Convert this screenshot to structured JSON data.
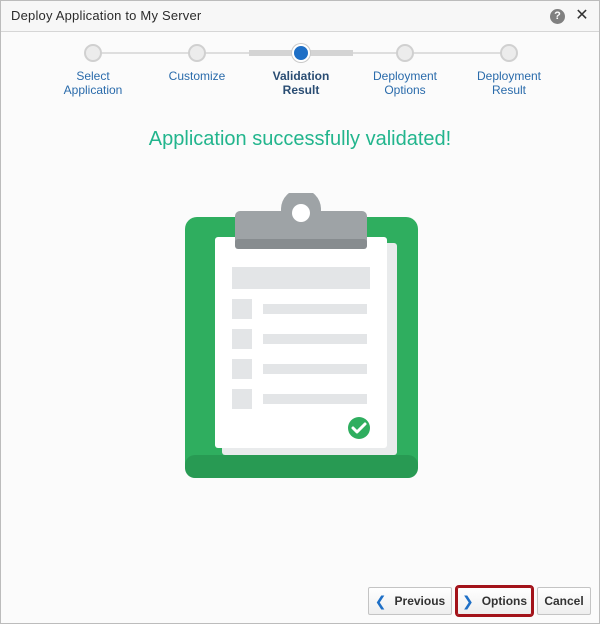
{
  "window": {
    "title": "Deploy Application to My Server"
  },
  "steps": [
    {
      "label_line1": "Select",
      "label_line2": "Application"
    },
    {
      "label_line1": "Customize",
      "label_line2": ""
    },
    {
      "label_line1": "Validation",
      "label_line2": "Result"
    },
    {
      "label_line1": "Deployment",
      "label_line2": "Options"
    },
    {
      "label_line1": "Deployment",
      "label_line2": "Result"
    }
  ],
  "current_step_index": 2,
  "main": {
    "headline": "Application successfully validated!"
  },
  "footer": {
    "previous_label": "Previous",
    "options_label": "Options",
    "cancel_label": "Cancel"
  },
  "icons": {
    "help": "help-icon",
    "close": "close-icon",
    "previous": "chevron-left-icon",
    "next": "chevron-right-icon",
    "illustration": "clipboard-check-icon"
  },
  "colors": {
    "accent": "#1e6fc6",
    "success": "#22b58d",
    "clipboard_green": "#2fae5f",
    "highlight": "#a3131a"
  }
}
